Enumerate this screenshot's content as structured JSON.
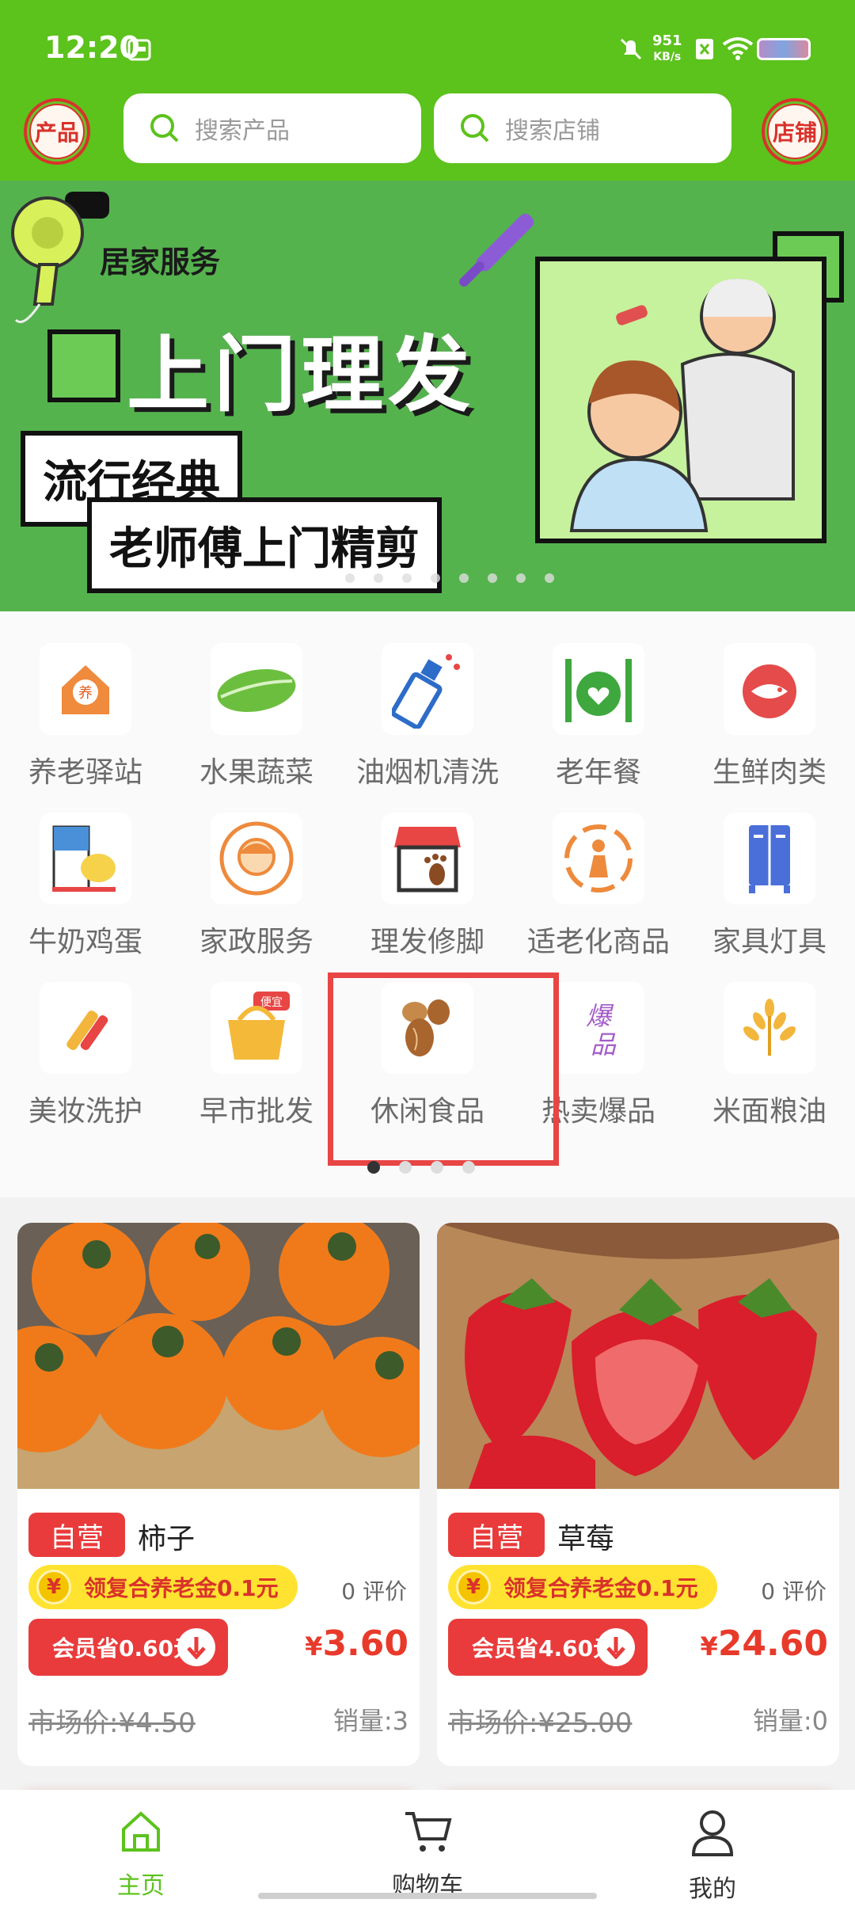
{
  "status": {
    "time": "12:20",
    "net_speed": "951",
    "net_unit": "KB/s"
  },
  "header": {
    "left_button": "产品",
    "right_button": "店铺",
    "search_product_placeholder": "搜索产品",
    "search_shop_placeholder": "搜索店铺"
  },
  "banner": {
    "tag": "居家服务",
    "title": "上门理发",
    "line1": "流行经典",
    "line2": "老师傅上门精剪",
    "slides": 9,
    "active_slide": 1
  },
  "categories": [
    {
      "label": "养老驿站",
      "icon": "elder-station-icon"
    },
    {
      "label": "水果蔬菜",
      "icon": "cabbage-icon"
    },
    {
      "label": "油烟机清洗",
      "icon": "spray-bottle-icon"
    },
    {
      "label": "老年餐",
      "icon": "meal-icon"
    },
    {
      "label": "生鲜肉类",
      "icon": "fish-icon"
    },
    {
      "label": "牛奶鸡蛋",
      "icon": "milk-egg-icon"
    },
    {
      "label": "家政服务",
      "icon": "housekeeping-icon"
    },
    {
      "label": "理发修脚",
      "icon": "barber-icon"
    },
    {
      "label": "适老化商品",
      "icon": "elder-goods-icon"
    },
    {
      "label": "家具灯具",
      "icon": "furniture-icon"
    },
    {
      "label": "美妆洗护",
      "icon": "cosmetics-icon"
    },
    {
      "label": "早市批发",
      "icon": "basket-icon"
    },
    {
      "label": "休闲食品",
      "icon": "nuts-icon"
    },
    {
      "label": "热卖爆品",
      "icon": "hot-sale-icon"
    },
    {
      "label": "米面粮油",
      "icon": "wheat-icon"
    }
  ],
  "category_pages": {
    "total": 4,
    "active": 1
  },
  "products": [
    {
      "badge": "自营",
      "name": "柿子",
      "coupon": "领复合养老金0.1元",
      "coupon_coin": "¥",
      "reviews": "0 评价",
      "member": "会员省0.60元",
      "price_symbol": "¥",
      "price": "3.60",
      "market_price": "市场价:¥4.50",
      "sales": "销量:3"
    },
    {
      "badge": "自营",
      "name": "草莓",
      "coupon": "领复合养老金0.1元",
      "coupon_coin": "¥",
      "reviews": "0 评价",
      "member": "会员省4.60元",
      "price_symbol": "¥",
      "price": "24.60",
      "market_price": "市场价:¥25.00",
      "sales": "销量:0"
    }
  ],
  "tabbar": [
    {
      "label": "主页",
      "icon": "home-icon",
      "active": true,
      "color": "#5cc21c"
    },
    {
      "label": "购物车",
      "icon": "cart-icon",
      "active": false
    },
    {
      "label": "我的",
      "icon": "user-icon",
      "active": false
    }
  ],
  "colors": {
    "brand_green": "#5cc21c",
    "accent_red": "#e93b3b",
    "coupon_yellow": "#ffe330"
  }
}
